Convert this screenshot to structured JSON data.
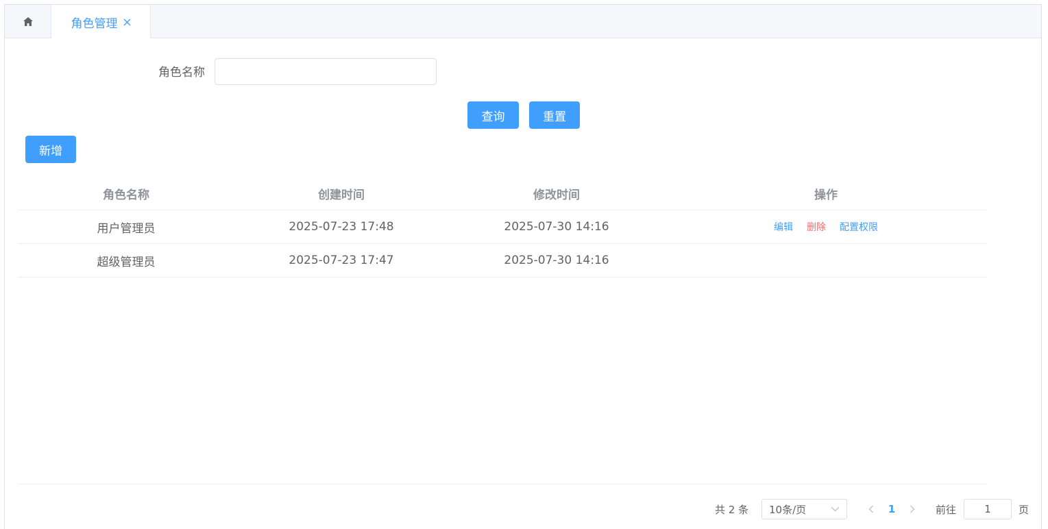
{
  "tabs": {
    "home_icon": "home-icon",
    "active_label": "角色管理",
    "close_icon": "close-icon"
  },
  "search": {
    "label": "角色名称",
    "value": "",
    "placeholder": ""
  },
  "buttons": {
    "query": "查询",
    "reset": "重置",
    "add": "新增"
  },
  "table": {
    "headers": [
      "角色名称",
      "创建时间",
      "修改时间",
      "操作"
    ],
    "rows": [
      {
        "name": "用户管理员",
        "created": "2025-07-23 17:48",
        "modified": "2025-07-30 14:16",
        "actions": [
          "编辑",
          "删除",
          "配置权限"
        ]
      },
      {
        "name": "超级管理员",
        "created": "2025-07-23 17:47",
        "modified": "2025-07-30 14:16",
        "actions": []
      }
    ]
  },
  "pagination": {
    "total": "共 2 条",
    "page_size": "10条/页",
    "current_page": "1",
    "goto_label": "前往",
    "goto_value": "1",
    "page_suffix": "页"
  },
  "colors": {
    "primary": "#409eff",
    "danger": "#f56c6c"
  }
}
